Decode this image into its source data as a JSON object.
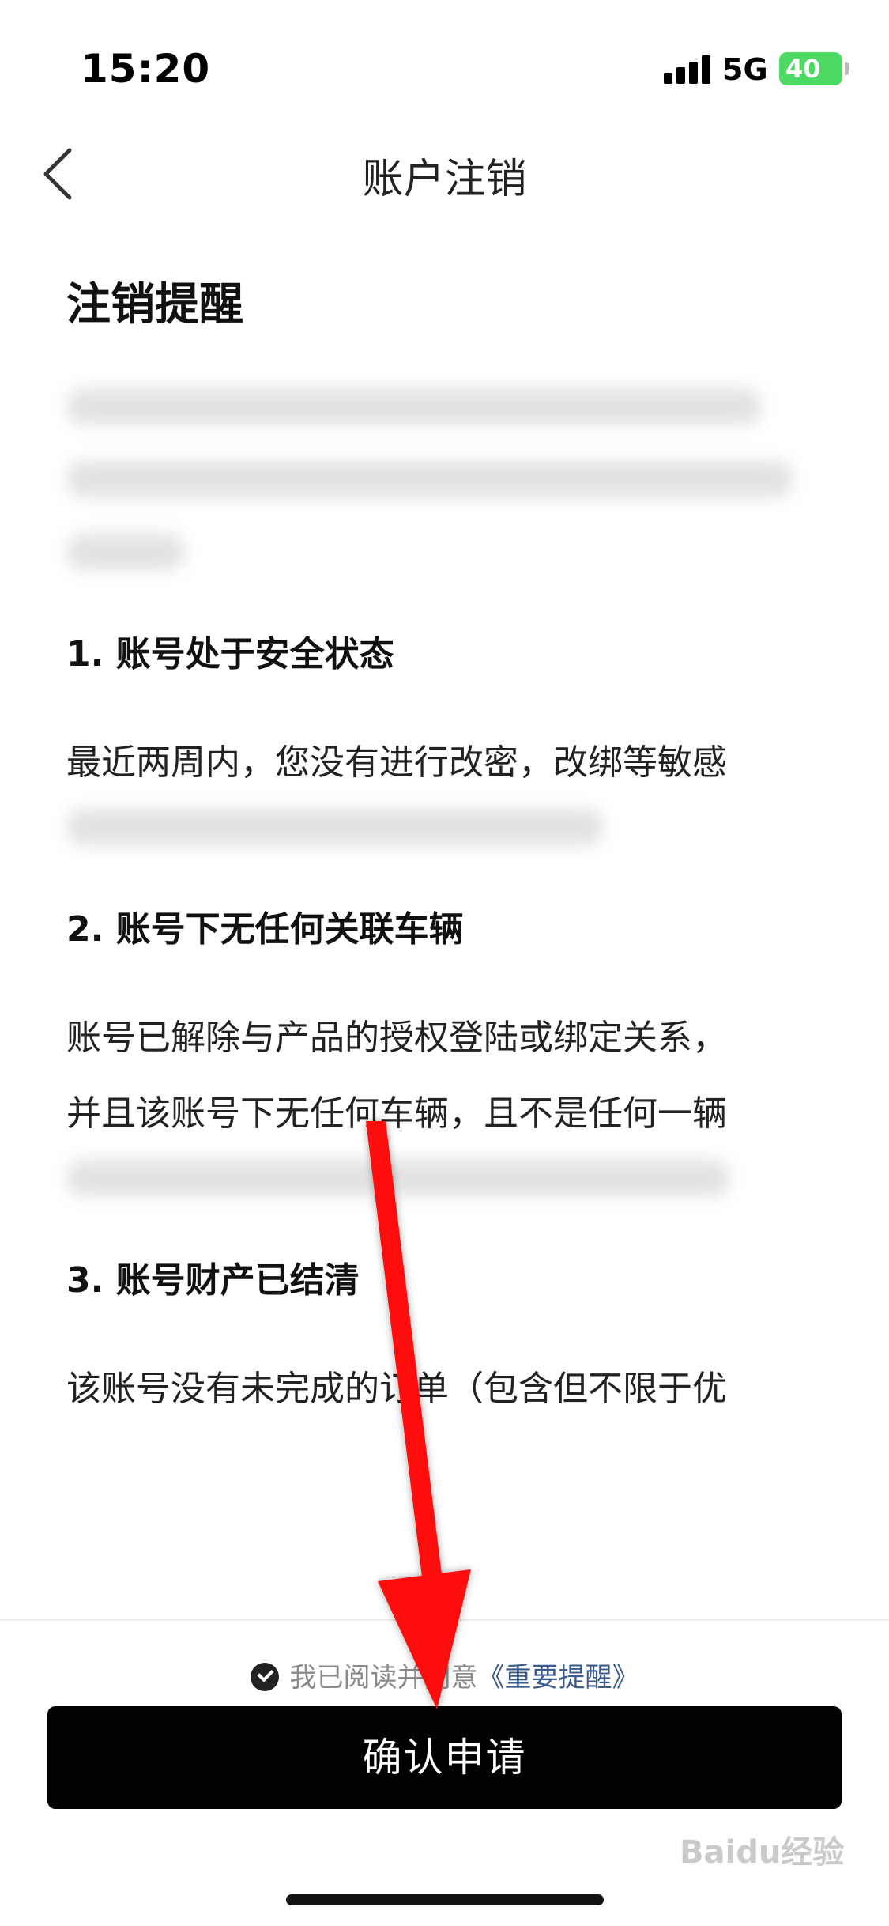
{
  "status_bar": {
    "time": "15:20",
    "network": "5G",
    "battery": "40"
  },
  "nav": {
    "title": "账户注销",
    "back_icon": "chevron-left-icon"
  },
  "content": {
    "section_title": "注销提醒",
    "items": [
      {
        "heading": "1. 账号处于安全状态",
        "text": "最近两周内，您没有进行改密，改绑等敏感"
      },
      {
        "heading": "2. 账号下无任何关联车辆",
        "text_line1": "账号已解除与产品的授权登陆或绑定关系，",
        "text_line2": "并且该账号下无任何车辆，且不是任何一辆"
      },
      {
        "heading": "3. 账号财产已结清",
        "text": "该账号没有未完成的订单（包含但不限于优"
      }
    ]
  },
  "bottom": {
    "agree_text": "我已阅读并同意",
    "agree_link": "《重要提醒》",
    "confirm_label": "确认申请"
  },
  "watermark": "Baidu经验",
  "colors": {
    "battery": "#4cd964",
    "link": "#3b5b8f",
    "arrow": "#ff1010",
    "button": "#000000"
  }
}
